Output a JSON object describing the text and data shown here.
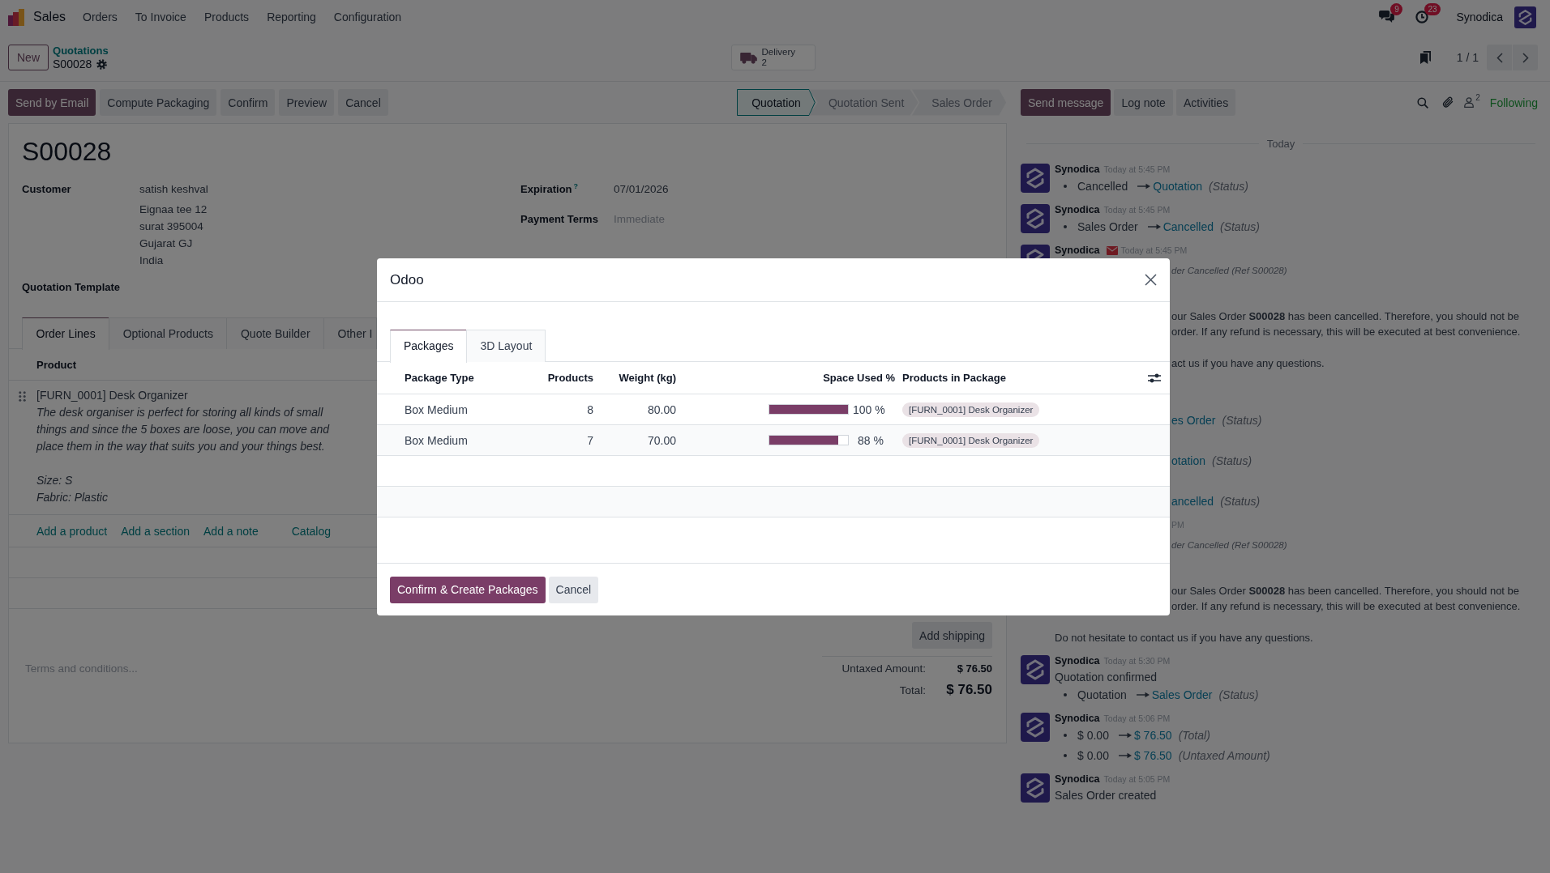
{
  "navbar": {
    "app_name": "Sales",
    "menu": [
      "Orders",
      "To Invoice",
      "Products",
      "Reporting",
      "Configuration"
    ],
    "messages_badge": "9",
    "activities_badge": "23",
    "user_name": "Synodica"
  },
  "control_panel": {
    "new_button": "New",
    "breadcrumb": "Quotations",
    "record_name": "S00028",
    "smart_buttons": [
      {
        "label": "Delivery",
        "count": "2"
      }
    ],
    "pager": "1 / 1"
  },
  "action_buttons": [
    {
      "label": "Send by Email",
      "kind": "primary"
    },
    {
      "label": "Compute Packaging",
      "kind": "secondary"
    },
    {
      "label": "Confirm",
      "kind": "secondary"
    },
    {
      "label": "Preview",
      "kind": "secondary"
    },
    {
      "label": "Cancel",
      "kind": "secondary"
    }
  ],
  "status_bar": [
    {
      "label": "Quotation",
      "selected": true
    },
    {
      "label": "Quotation Sent",
      "selected": false
    },
    {
      "label": "Sales Order",
      "selected": false
    }
  ],
  "form": {
    "title": "S00028",
    "customer": {
      "label": "Customer",
      "name": "satish keshval",
      "address": [
        "Eignaa tee 12",
        "surat 395004",
        "Gujarat GJ",
        "India"
      ]
    },
    "quotation_template": {
      "label": "Quotation Template"
    },
    "expiration": {
      "label": "Expiration",
      "help": "?",
      "value": "07/01/2026"
    },
    "payment_terms": {
      "label": "Payment Terms",
      "placeholder": "Immediate"
    },
    "tabs": [
      {
        "label": "Order Lines",
        "selected": true
      },
      {
        "label": "Optional Products",
        "selected": false
      },
      {
        "label": "Quote Builder",
        "selected": false
      },
      {
        "label": "Other I",
        "selected": false
      }
    ],
    "order_lines": {
      "columns": [
        "Product"
      ],
      "rows": [
        {
          "product": "[FURN_0001] Desk Organizer",
          "description": "The desk organiser is perfect for storing all kinds of small things and since the 5 boxes are loose, you can move and place them in the way that suits you and your things best.\n\nSize: S\nFabric: Plastic"
        }
      ],
      "add_links": [
        {
          "label": "Add a product",
          "kind": "line"
        },
        {
          "label": "Add a section",
          "kind": "line"
        },
        {
          "label": "Add a note",
          "kind": "line"
        },
        {
          "label": "Catalog",
          "kind": "catalog"
        }
      ]
    },
    "add_shipping": "Add shipping",
    "terms": {
      "placeholder": "Terms and conditions..."
    },
    "totals": [
      {
        "label": "Untaxed Amount:",
        "value": "$ 76.50",
        "kind": "subtotal"
      },
      {
        "label": "Total:",
        "value": "$ 76.50",
        "kind": "total"
      }
    ]
  },
  "chatter": {
    "buttons": [
      {
        "label": "Send message",
        "kind": "primary"
      },
      {
        "label": "Log note",
        "kind": "secondary"
      },
      {
        "label": "Activities",
        "kind": "secondary"
      }
    ],
    "followers_count": "2",
    "follow_status": "Following",
    "date_divider": "Today",
    "messages": [
      {
        "kind": "tracking",
        "cut_off": false,
        "author": "Synodica",
        "time": "Today at 5:45 PM",
        "changes": [
          {
            "old": "Cancelled",
            "new": "Quotation",
            "field": "(Status)"
          }
        ]
      },
      {
        "kind": "tracking",
        "cut_off": false,
        "author": "Synodica",
        "time": "Today at 5:45 PM",
        "changes": [
          {
            "old": "Sales Order",
            "new": "Cancelled",
            "field": "(Status)"
          }
        ]
      },
      {
        "kind": "email",
        "cut_off": false,
        "author": "Synodica",
        "time": "Today at 5:45 PM",
        "cut_lines": [
          {
            "kind": "subject",
            "text": "der Cancelled (Ref S00028)"
          },
          {
            "kind": "text",
            "text": "our Sales Order **S00028** has been cancelled. Therefore, you should not be"
          },
          {
            "kind": "text",
            "text": "order. If any refund is necessary, this will be executed at best convenience."
          },
          {
            "kind": "closing",
            "text": "act us if you have any questions."
          }
        ]
      },
      {
        "kind": "confirmation",
        "cut_off": true,
        "changes": [
          {
            "new": "es Order",
            "field": "(Status)"
          }
        ]
      },
      {
        "kind": "tracking",
        "cut_off": true,
        "changes": [
          {
            "new": "otation",
            "field": "(Status)"
          }
        ]
      },
      {
        "kind": "tracking",
        "cut_off": true,
        "changes": [
          {
            "new": "ancelled",
            "field": "(Status)"
          }
        ]
      },
      {
        "kind": "email",
        "cut_off": true,
        "time": "PM",
        "cut_lines": [
          {
            "kind": "subject",
            "text": "der Cancelled (Ref S00028)"
          },
          {
            "kind": "text",
            "text": "our Sales Order **S00028** has been cancelled. Therefore, you should not be"
          },
          {
            "kind": "text",
            "text": "order. If any refund is necessary, this will be executed at best convenience."
          }
        ],
        "lines": [
          {
            "kind": "closing",
            "text": "Do not hesitate to contact us if you have any questions."
          }
        ]
      },
      {
        "kind": "confirmation",
        "cut_off": false,
        "author": "Synodica",
        "time": "Today at 5:30 PM",
        "title": "Quotation confirmed",
        "changes": [
          {
            "old": "Quotation",
            "new": "Sales Order",
            "field": "(Status)"
          }
        ]
      },
      {
        "kind": "tracking",
        "cut_off": false,
        "author": "Synodica",
        "time": "Today at 5:06 PM",
        "changes": [
          {
            "old": "$ 0.00",
            "new": "$ 76.50",
            "field": "(Total)"
          },
          {
            "old": "$ 0.00",
            "new": "$ 76.50",
            "field": "(Untaxed Amount)"
          }
        ]
      },
      {
        "kind": "note",
        "cut_off": false,
        "author": "Synodica",
        "time": "Today at 5:05 PM",
        "body": "Sales Order created"
      }
    ]
  },
  "dialog": {
    "title": "Odoo",
    "tabs": [
      {
        "label": "Packages",
        "selected": true
      },
      {
        "label": "3D Layout",
        "selected": false
      }
    ],
    "packages": {
      "columns": [
        "Package Type",
        "Products",
        "Weight (kg)",
        "Space Used %",
        "Products in Package"
      ],
      "rows": [
        {
          "package_type": "Box Medium",
          "products": "8",
          "weight": "80.00",
          "level": 1.0,
          "space_used": "100 %",
          "contents": [
            "[FURN_0001] Desk Organizer"
          ]
        },
        {
          "package_type": "Box Medium",
          "products": "7",
          "weight": "70.00",
          "level": 0.88,
          "space_used": "88 %",
          "contents": [
            "[FURN_0001] Desk Organizer"
          ]
        }
      ]
    },
    "buttons": [
      {
        "label": "Confirm & Create Packages",
        "kind": "primary"
      },
      {
        "label": "Cancel",
        "kind": "secondary"
      }
    ]
  }
}
